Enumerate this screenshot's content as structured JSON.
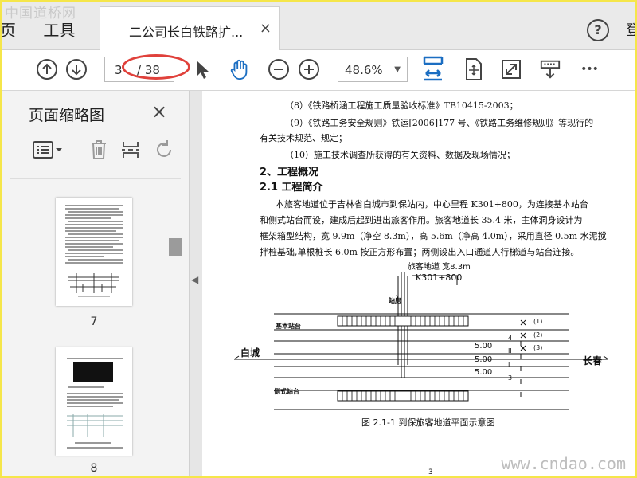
{
  "watermark_top": "中国道桥网",
  "watermark_bottom": "www.cndao.com",
  "tabs": {
    "home_partial": "页",
    "tools": "工具",
    "document_title": "二公司长白铁路扩...",
    "close": "×",
    "help": "?",
    "login_partial": "登"
  },
  "toolbar": {
    "page_current": "3",
    "page_total": "/ 38",
    "zoom_value": "48.6%",
    "more": "•••"
  },
  "sidebar": {
    "title": "页面缩略图",
    "close": "×",
    "thumbnails": [
      {
        "label": "7"
      },
      {
        "label": "8"
      }
    ]
  },
  "document": {
    "lines": [
      "（8）《铁路桥涵工程施工质量验收标准》TB10415-2003；",
      "（9）《铁路工务安全规则》铁运[2006]177 号、《铁路工务维修规则》等现行的",
      "有关技术规范、规定；",
      "（10）施工技术调查所获得的有关资料、数据及现场情况；"
    ],
    "heading_2": "2、工程概况",
    "heading_21": "2.1 工程简介",
    "para": [
      "本旅客地道位于吉林省白城市到保站内，中心里程 K301+800，为连接基本站台",
      "和侧式站台而设，建成后起到进出旅客作用。旅客地道长 35.4 米，主体洞身设计为",
      "框架箱型结构，宽 9.9m（净空 8.3m），高 5.6m（净高 4.0m），采用直径 0.5m 水泥搅",
      "拌桩基础,单根桩长 6.0m 按正方形布置；两侧设出入口通道人行梯道与站台连接。"
    ],
    "page_number": "3"
  },
  "diagram": {
    "label_top": "旅客地道  宽8.3m",
    "label_km": "K301+800",
    "label_rail": "站房",
    "label_basic": "基本站台",
    "label_side": "侧式站台",
    "label_left_city": "白城",
    "label_right_city": "长春",
    "dist_labels": [
      "5.00",
      "5.00",
      "5.00"
    ],
    "track_labels": [
      "(1)",
      "(2)",
      "(3)"
    ],
    "roman": [
      "4",
      "II",
      "I",
      "3"
    ],
    "caption": "图 2.1-1   到保旅客地道平面示意图"
  }
}
